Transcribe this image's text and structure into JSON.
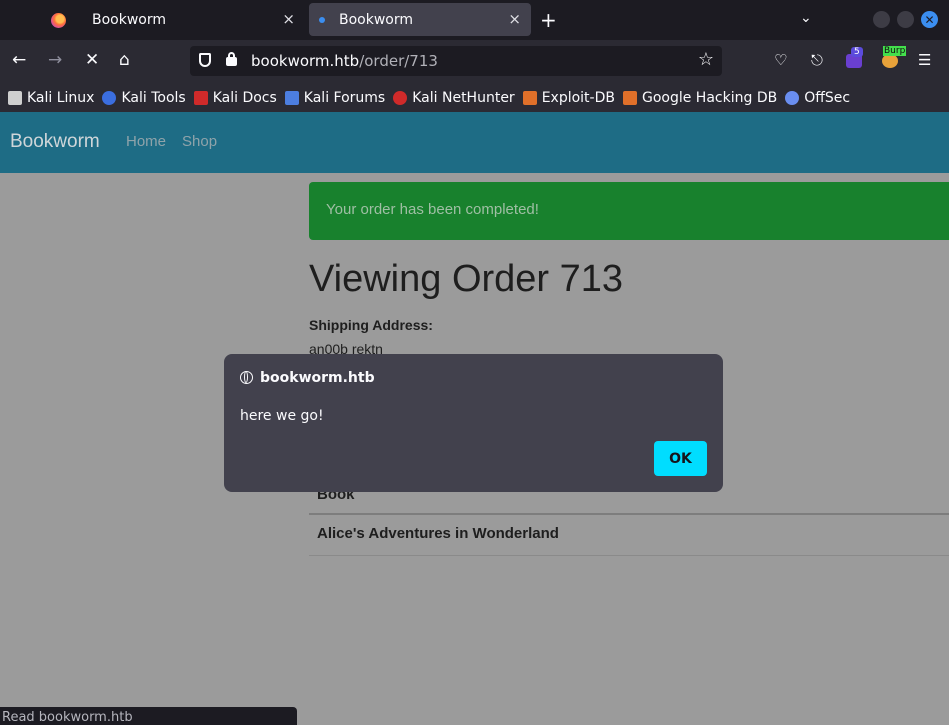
{
  "browser": {
    "tabs": [
      {
        "title": "Bookworm"
      },
      {
        "title": "Bookworm"
      }
    ],
    "new_tab_icon": "+",
    "tab_close_icon": "×",
    "url": {
      "host": "bookworm.htb",
      "path": "/order/713"
    },
    "extension_badge": "5",
    "burp_label": "Burp",
    "bookmarks": [
      {
        "label": "Kali Linux",
        "color": "#e8e8e8"
      },
      {
        "label": "Kali Tools",
        "color": "#3b6ee0"
      },
      {
        "label": "Kali Docs",
        "color": "#d02a2a"
      },
      {
        "label": "Kali Forums",
        "color": "#4c7ee0"
      },
      {
        "label": "Kali NetHunter",
        "color": "#d02a2a"
      },
      {
        "label": "Exploit-DB",
        "color": "#e0702a"
      },
      {
        "label": "Google Hacking DB",
        "color": "#e0702a"
      },
      {
        "label": "OffSec",
        "color": "#6a8ef0"
      }
    ],
    "status_text": "Read bookworm.htb"
  },
  "site": {
    "brand": "Bookworm",
    "nav": [
      {
        "label": "Home"
      },
      {
        "label": "Shop"
      }
    ],
    "alert": "Your order has been completed!",
    "order_title": "Viewing Order 713",
    "shipping_label": "Shipping Address:",
    "shipping_value": "an00b rektn",
    "table": {
      "header": "Book",
      "rows": [
        "Alice's Adventures in Wonderland"
      ]
    }
  },
  "dialog": {
    "origin": "bookworm.htb",
    "message": "here we go!",
    "ok_label": "OK"
  }
}
